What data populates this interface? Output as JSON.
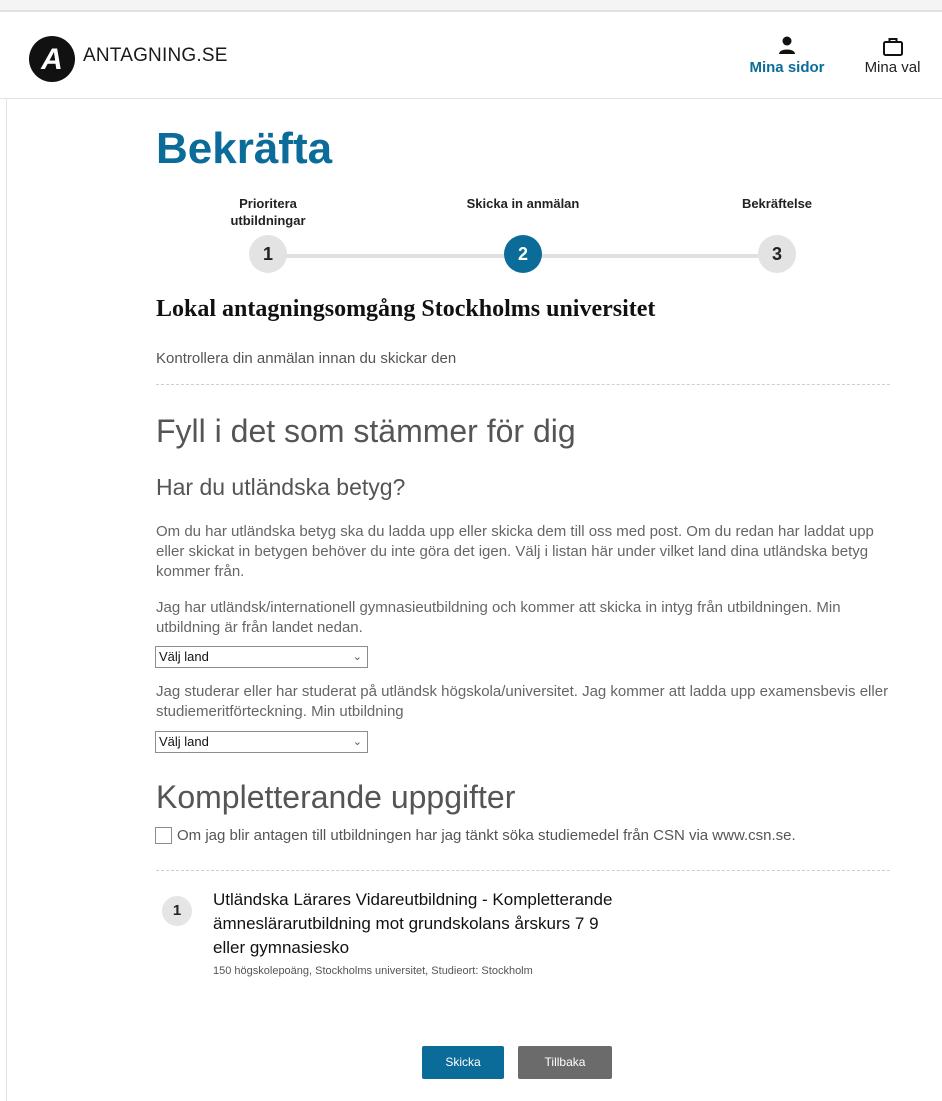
{
  "header": {
    "brand": "ANTAGNING.SE",
    "logo_letter": "A",
    "nav": [
      {
        "label": "Mina sidor",
        "icon": "person-icon"
      },
      {
        "label": "Mina val",
        "icon": "briefcase-icon"
      }
    ]
  },
  "page": {
    "title": "Bekräfta",
    "steps": [
      {
        "label": "Prioritera utbildningar",
        "number": "1",
        "state": "done"
      },
      {
        "label": "Skicka in anmälan",
        "number": "2",
        "state": "current"
      },
      {
        "label": "Bekräftelse",
        "number": "3",
        "state": "upcoming"
      }
    ],
    "round_title": "Lokal antagningsomgång Stockholms universitet",
    "lead": "Kontrollera din anmälan innan du skickar den"
  },
  "form": {
    "heading": "Fyll i det som stämmer för dig",
    "foreign_grades": {
      "heading": "Har du utländska betyg?",
      "intro": "Om du har utländska betyg ska du ladda upp eller skicka dem till oss med post. Om du redan har laddat upp eller skickat in betygen behöver du inte göra det igen. Välj i listan här under vilket land dina utländska betyg kommer från.",
      "secondary_text": "Jag har utländsk/internationell gymnasieutbildning och kommer att skicka in intyg från utbildningen. Min utbildning är från landet nedan.",
      "secondary_select": "Välj land",
      "university_text": "Jag studerar eller har studerat på utländsk högskola/universitet. Jag kommer att ladda upp examensbevis eller studiemeritförteckning. Min utbildning",
      "university_select": "Välj land"
    },
    "supplementary": {
      "heading": "Kompletterande uppgifter",
      "csn_checkbox_label": "Om jag blir antagen till utbildningen har jag tänkt söka studiemedel från CSN via www.csn.se.",
      "csn_checked": false
    }
  },
  "courses": [
    {
      "priority": "1",
      "title": "Utländska Lärares Vidareutbildning - Kompletterande ämneslärarutbildning mot grundskolans årskurs 7 9 eller gymnasiesko",
      "meta": "150 högskolepoäng, Stockholms universitet, Studieort: Stockholm"
    }
  ],
  "actions": {
    "submit": "Skicka",
    "back": "Tillbaka"
  },
  "colors": {
    "primary": "#0b6c9a",
    "secondary_button": "#6b6b6b",
    "step_inactive": "#e3e3e3"
  }
}
